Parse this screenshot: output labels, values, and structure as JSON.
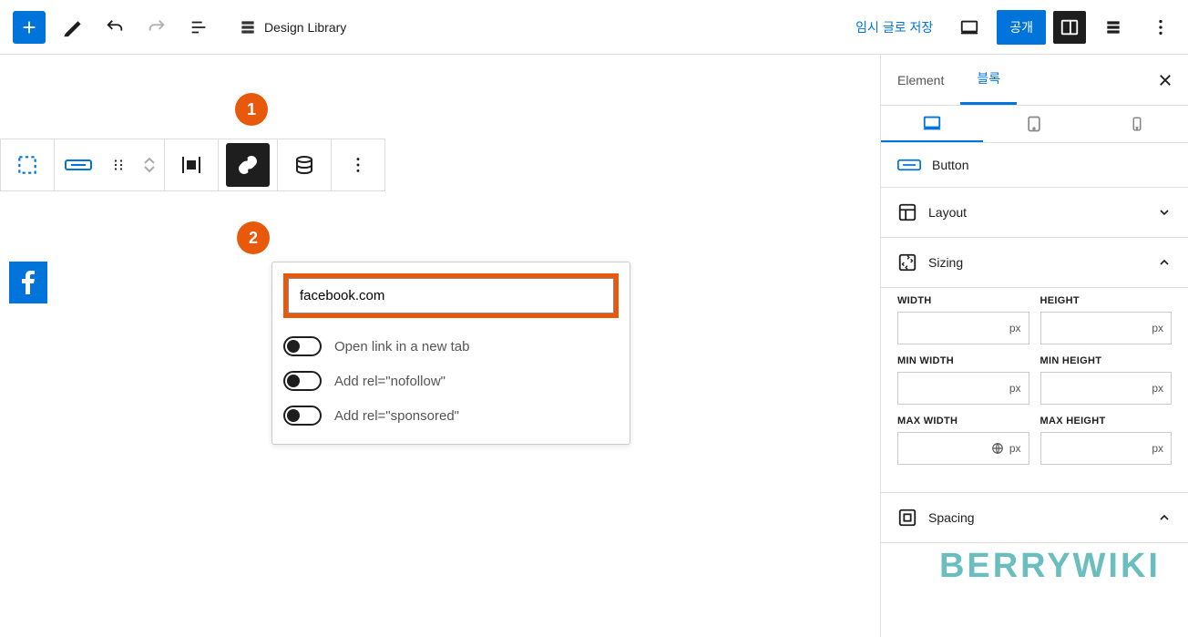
{
  "topbar": {
    "design_library": "Design Library",
    "save_draft": "임시 글로 저장",
    "publish": "공개"
  },
  "link_popup": {
    "url_value": "facebook.com",
    "opt_newtab": "Open link in a new tab",
    "opt_nofollow": "Add rel=\"nofollow\"",
    "opt_sponsored": "Add rel=\"sponsored\""
  },
  "annotations": {
    "one": "1",
    "two": "2"
  },
  "sidebar": {
    "tab_element": "Element",
    "tab_block": "블록",
    "button_label": "Button",
    "layout_label": "Layout",
    "sizing_label": "Sizing",
    "spacing_label": "Spacing",
    "fields": {
      "width": "WIDTH",
      "height": "HEIGHT",
      "min_width": "MIN WIDTH",
      "min_height": "MIN HEIGHT",
      "max_width": "MAX WIDTH",
      "max_height": "MAX HEIGHT",
      "unit": "px"
    }
  },
  "watermark": "BERRYWIKI"
}
